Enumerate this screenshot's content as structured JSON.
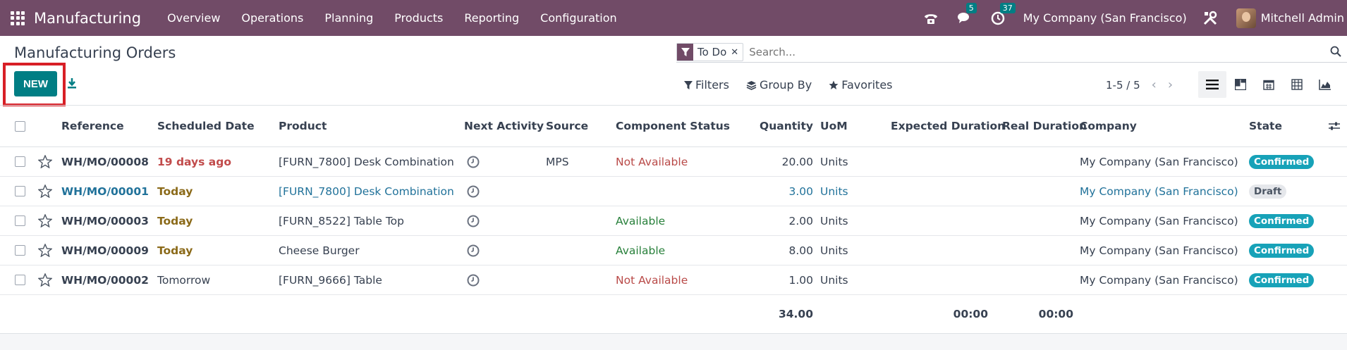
{
  "app": {
    "name": "Manufacturing",
    "menu": [
      "Overview",
      "Operations",
      "Planning",
      "Products",
      "Reporting",
      "Configuration"
    ],
    "messages_badge": "5",
    "activities_badge": "37",
    "company": "My Company (San Francisco)",
    "user": "Mitchell Admin"
  },
  "page": {
    "title": "Manufacturing Orders",
    "new_label": "NEW"
  },
  "search": {
    "facet": "To Do",
    "placeholder": "Search..."
  },
  "toolbar": {
    "filters": "Filters",
    "group_by": "Group By",
    "favorites": "Favorites",
    "pager": "1-5 / 5"
  },
  "table": {
    "headers": {
      "reference": "Reference",
      "scheduled_date": "Scheduled Date",
      "product": "Product",
      "next_activity": "Next Activity",
      "source": "Source",
      "component_status": "Component Status",
      "quantity": "Quantity",
      "uom": "UoM",
      "expected_duration": "Expected Duration",
      "real_duration": "Real Duration",
      "company": "Company",
      "state": "State"
    },
    "rows": [
      {
        "reference": "WH/MO/00008",
        "scheduled_date": "19 days ago",
        "product": "[FURN_7800] Desk Combination",
        "source": "MPS",
        "component_status": "Not Available",
        "quantity": "20.00",
        "uom": "Units",
        "company": "My Company (San Francisco)",
        "state": "Confirmed"
      },
      {
        "reference": "WH/MO/00001",
        "scheduled_date": "Today",
        "product": "[FURN_7800] Desk Combination",
        "source": "",
        "component_status": "",
        "quantity": "3.00",
        "uom": "Units",
        "company": "My Company (San Francisco)",
        "state": "Draft"
      },
      {
        "reference": "WH/MO/00003",
        "scheduled_date": "Today",
        "product": "[FURN_8522] Table Top",
        "source": "",
        "component_status": "Available",
        "quantity": "2.00",
        "uom": "Units",
        "company": "My Company (San Francisco)",
        "state": "Confirmed"
      },
      {
        "reference": "WH/MO/00009",
        "scheduled_date": "Today",
        "product": "Cheese Burger",
        "source": "",
        "component_status": "Available",
        "quantity": "8.00",
        "uom": "Units",
        "company": "My Company (San Francisco)",
        "state": "Confirmed"
      },
      {
        "reference": "WH/MO/00002",
        "scheduled_date": "Tomorrow",
        "product": "[FURN_9666] Table",
        "source": "",
        "component_status": "Not Available",
        "quantity": "1.00",
        "uom": "Units",
        "company": "My Company (San Francisco)",
        "state": "Confirmed"
      }
    ],
    "totals": {
      "quantity": "34.00",
      "expected_duration": "00:00",
      "real_duration": "00:00"
    }
  },
  "colors": {
    "navbar": "#714b67",
    "primary": "#017e84",
    "highlight": "#d81f26",
    "confirmed": "#17a2b8"
  }
}
